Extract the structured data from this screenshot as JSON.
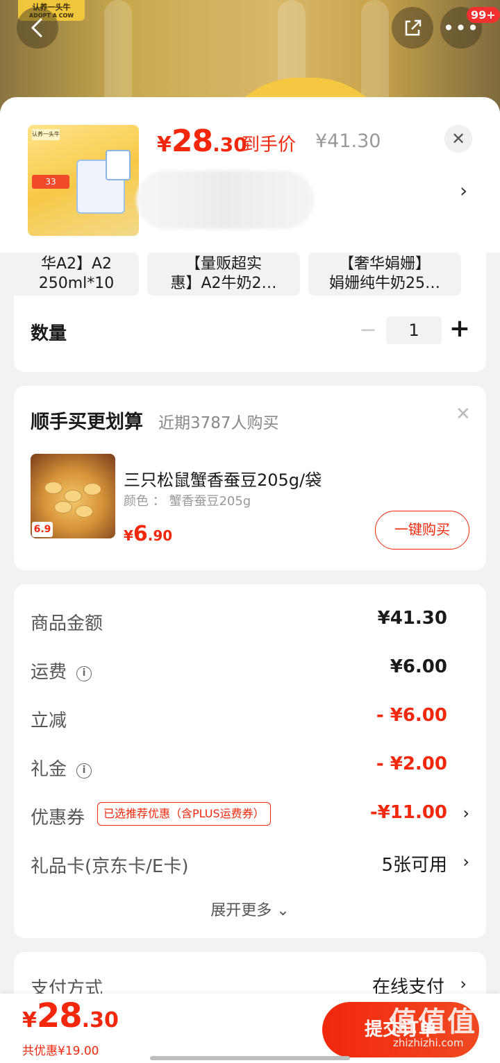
{
  "header": {
    "brand_logo_line1": "认养一头牛",
    "brand_logo_line2": "ADOPT A COW",
    "notification_badge": "99+"
  },
  "product": {
    "price_currency": "¥",
    "price_int": "28",
    "price_dec": ".30",
    "price_tag": "到手价",
    "original_price": "¥41.30",
    "thumb_tag": "33"
  },
  "specs": [
    {
      "line1": "华A2】A2",
      "line2": "250ml*10"
    },
    {
      "line1": "【量贩超实",
      "line2": "惠】A2牛奶2…"
    },
    {
      "line1": "【奢华娟姗】",
      "line2": "娟姗纯牛奶25…"
    }
  ],
  "quantity": {
    "label": "数量",
    "minus": "−",
    "value": "1",
    "plus": "+"
  },
  "upsell": {
    "title": "顺手买更划算",
    "subtitle": "近期3787人购买",
    "item_name": "三只松鼠蟹香蚕豆205g/袋",
    "item_attr": "颜色 ： 蟹香蚕豆205g",
    "price_currency": "¥",
    "price_int": "6",
    "price_dec": ".90",
    "img_price_tag": "6.9",
    "buy_label": "一键购买"
  },
  "costs": {
    "goods_label": "商品金额",
    "goods_value": "¥41.30",
    "shipping_label": "运费",
    "shipping_value": "¥6.00",
    "discount_label": "立减",
    "discount_value": "- ¥6.00",
    "gift_label": "礼金",
    "gift_value": "- ¥2.00",
    "coupon_label": "优惠券",
    "coupon_tag": "已选推荐优惠（含PLUS运费券）",
    "coupon_value": "-¥11.00",
    "giftcard_label": "礼品卡(京东卡/E卡)",
    "giftcard_value": "5张可用",
    "expand_label": "展开更多 ⌄"
  },
  "payment": {
    "label": "支付方式",
    "value": "在线支付"
  },
  "bottom": {
    "price_currency": "¥",
    "price_int": "28",
    "price_dec": ".30",
    "saved": "共优惠¥19.00",
    "submit": "提交订单"
  },
  "watermark": {
    "line1": "值值值",
    "line2": "zhizhizhi.com"
  },
  "colors": {
    "accent": "#f2270c",
    "background": "#f2f2f2"
  }
}
